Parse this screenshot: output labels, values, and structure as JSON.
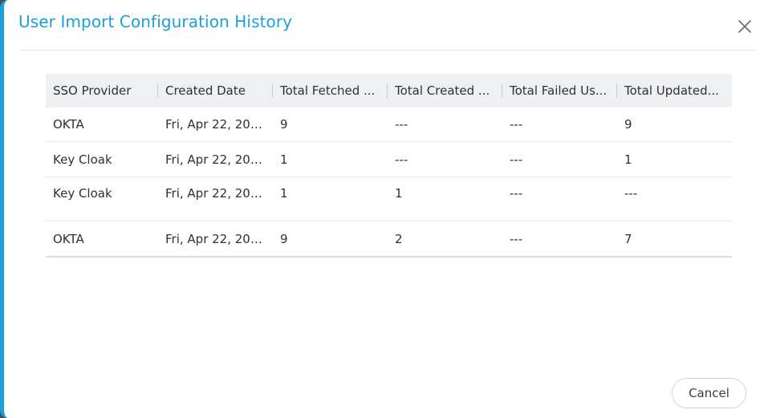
{
  "modal": {
    "title": "User Import Configuration History",
    "close_icon": "close-icon",
    "cancel_label": "Cancel"
  },
  "table": {
    "columns": [
      "SSO Provider",
      "Created Date",
      "Total Fetched ...",
      "Total Created ...",
      "Total Failed Us...",
      "Total Updated..."
    ],
    "rows": [
      [
        "OKTA",
        "Fri, Apr 22, 202...",
        "9",
        "---",
        "---",
        "9"
      ],
      [
        "Key Cloak",
        "Fri, Apr 22, 202...",
        "1",
        "---",
        "---",
        "1"
      ],
      [
        "Key Cloak",
        "Fri, Apr 22, 202...",
        "1",
        "1",
        "---",
        "---"
      ],
      [
        "OKTA",
        "Fri, Apr 22, 202...",
        "9",
        "2",
        "---",
        "7"
      ]
    ]
  },
  "colors": {
    "accent": "#1a9fdc",
    "header_bg": "#eef0f4",
    "backdrop": "#4a4f55"
  }
}
